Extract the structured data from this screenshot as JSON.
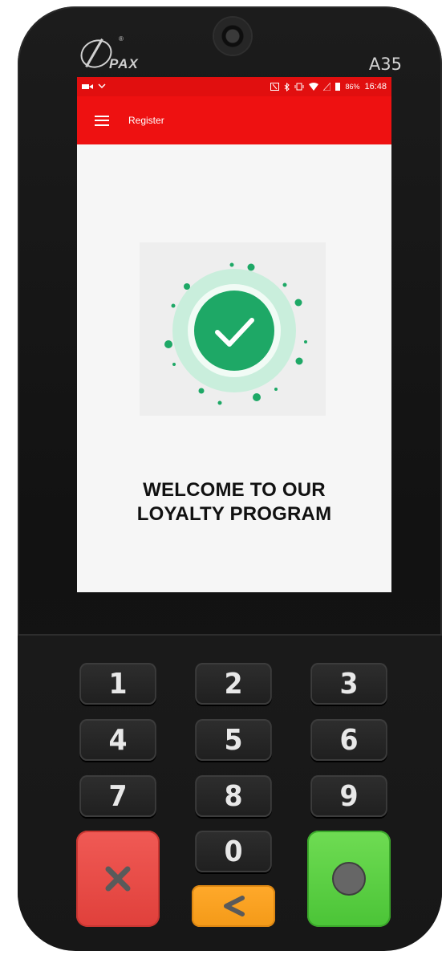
{
  "device": {
    "brand": "PAX",
    "model": "A35"
  },
  "status_bar": {
    "battery": "86%",
    "time": "16:48"
  },
  "app_bar": {
    "title": "Register"
  },
  "main": {
    "welcome_line1": "WELCOME TO OUR",
    "welcome_line2": "LOYALTY PROGRAM"
  },
  "keypad": {
    "keys": [
      "1",
      "2",
      "3",
      "4",
      "5",
      "6",
      "7",
      "8",
      "9",
      "0"
    ],
    "cancel_icon": "x-icon",
    "back_icon": "chevron-left-icon",
    "enter_icon": "circle-icon"
  },
  "colors": {
    "accent": "#ee1111",
    "success": "#1ea866",
    "success_light": "#c9eedc",
    "cancel": "#e8453f",
    "enter": "#58cf41",
    "back": "#f7a020"
  }
}
